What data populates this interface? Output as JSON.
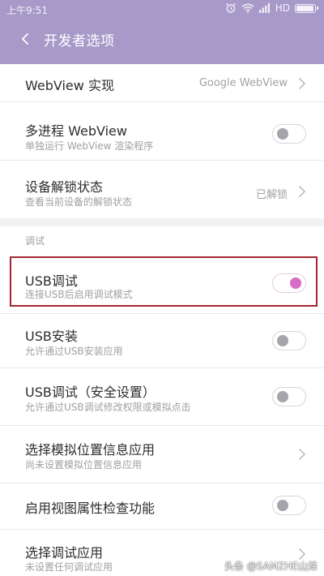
{
  "status": {
    "time": "上午9:51",
    "network": "HD",
    "icons": [
      "alarm-icon",
      "wifi-icon",
      "signal-icon",
      "battery-icon"
    ]
  },
  "header": {
    "title": "开发者选项",
    "color": "#a79ac9"
  },
  "rows": {
    "webview": {
      "title": "WebView 实现",
      "value": "Google WebView"
    },
    "multiprocess": {
      "title": "多进程 WebView",
      "subtitle": "单独运行 WebView 渲染程序",
      "enabled": false
    },
    "unlock_state": {
      "title": "设备解锁状态",
      "subtitle": "查看当前设备的解锁状态",
      "value": "已解锁"
    },
    "usb_debug": {
      "title": "USB调试",
      "subtitle": "连接USB后启用调试模式",
      "enabled": true
    },
    "usb_install": {
      "title": "USB安装",
      "subtitle": "允许通过USB安装应用",
      "enabled": false
    },
    "usb_debug_secure": {
      "title": "USB调试（安全设置）",
      "subtitle": "允许通过USB调试修改权限或模拟点击",
      "enabled": false
    },
    "mock_location": {
      "title": "选择模拟位置信息应用",
      "subtitle": "尚未设置模拟位置信息应用"
    },
    "view_attr": {
      "title": "启用视图属性检查功能",
      "enabled": false
    },
    "debug_app": {
      "title": "选择调试应用",
      "subtitle": "未设置任何调试应用"
    }
  },
  "section": {
    "debug_label": "调试"
  },
  "colors": {
    "toggle_on": "#d86cc6",
    "toggle_off": "#a7a3ac",
    "highlight": "#a32733"
  },
  "watermark": "头条 @SAMZHE山泽"
}
